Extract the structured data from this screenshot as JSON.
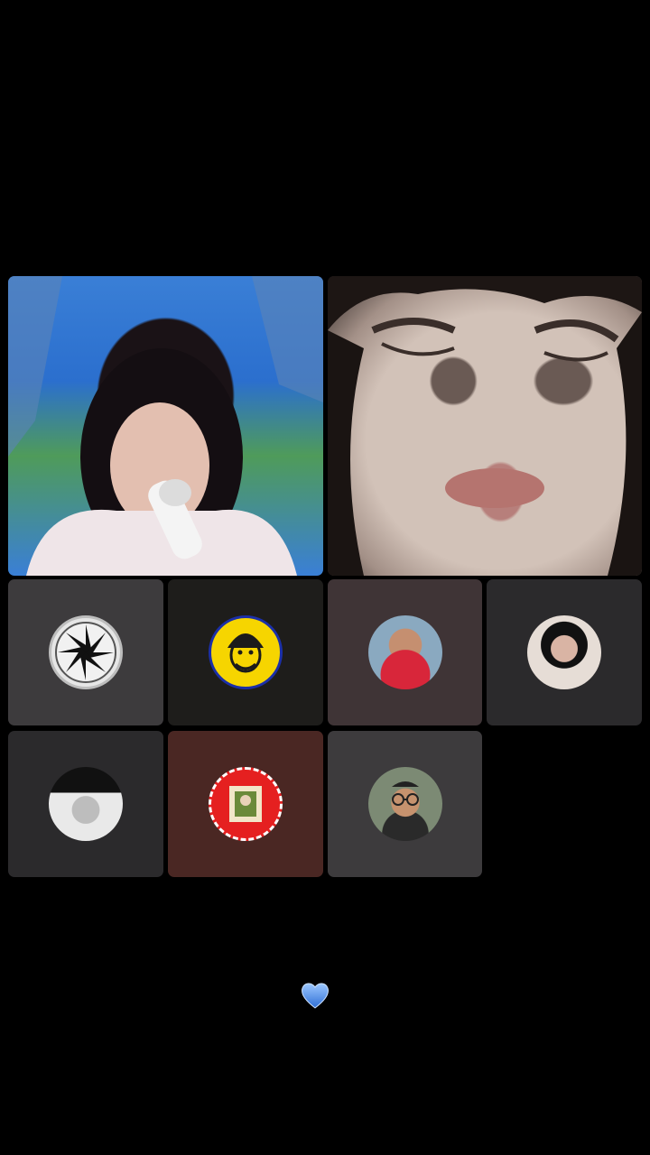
{
  "room": {
    "hosts": [
      {
        "name": "host-singer-video"
      },
      {
        "name": "host-closeup-video"
      }
    ],
    "guests": [
      {
        "avatar": "star-pattern-avatar"
      },
      {
        "avatar": "yellow-cartoon-avatar"
      },
      {
        "avatar": "red-cap-man-avatar"
      },
      {
        "avatar": "woman-headscarf-avatar"
      },
      {
        "avatar": "man-hat-avatar"
      },
      {
        "avatar": "red-badge-avatar"
      },
      {
        "avatar": "man-glasses-avatar"
      }
    ],
    "reaction_icon": "blue-heart-icon"
  },
  "colors": {
    "background": "#000000",
    "heart": "#3b82f6"
  }
}
